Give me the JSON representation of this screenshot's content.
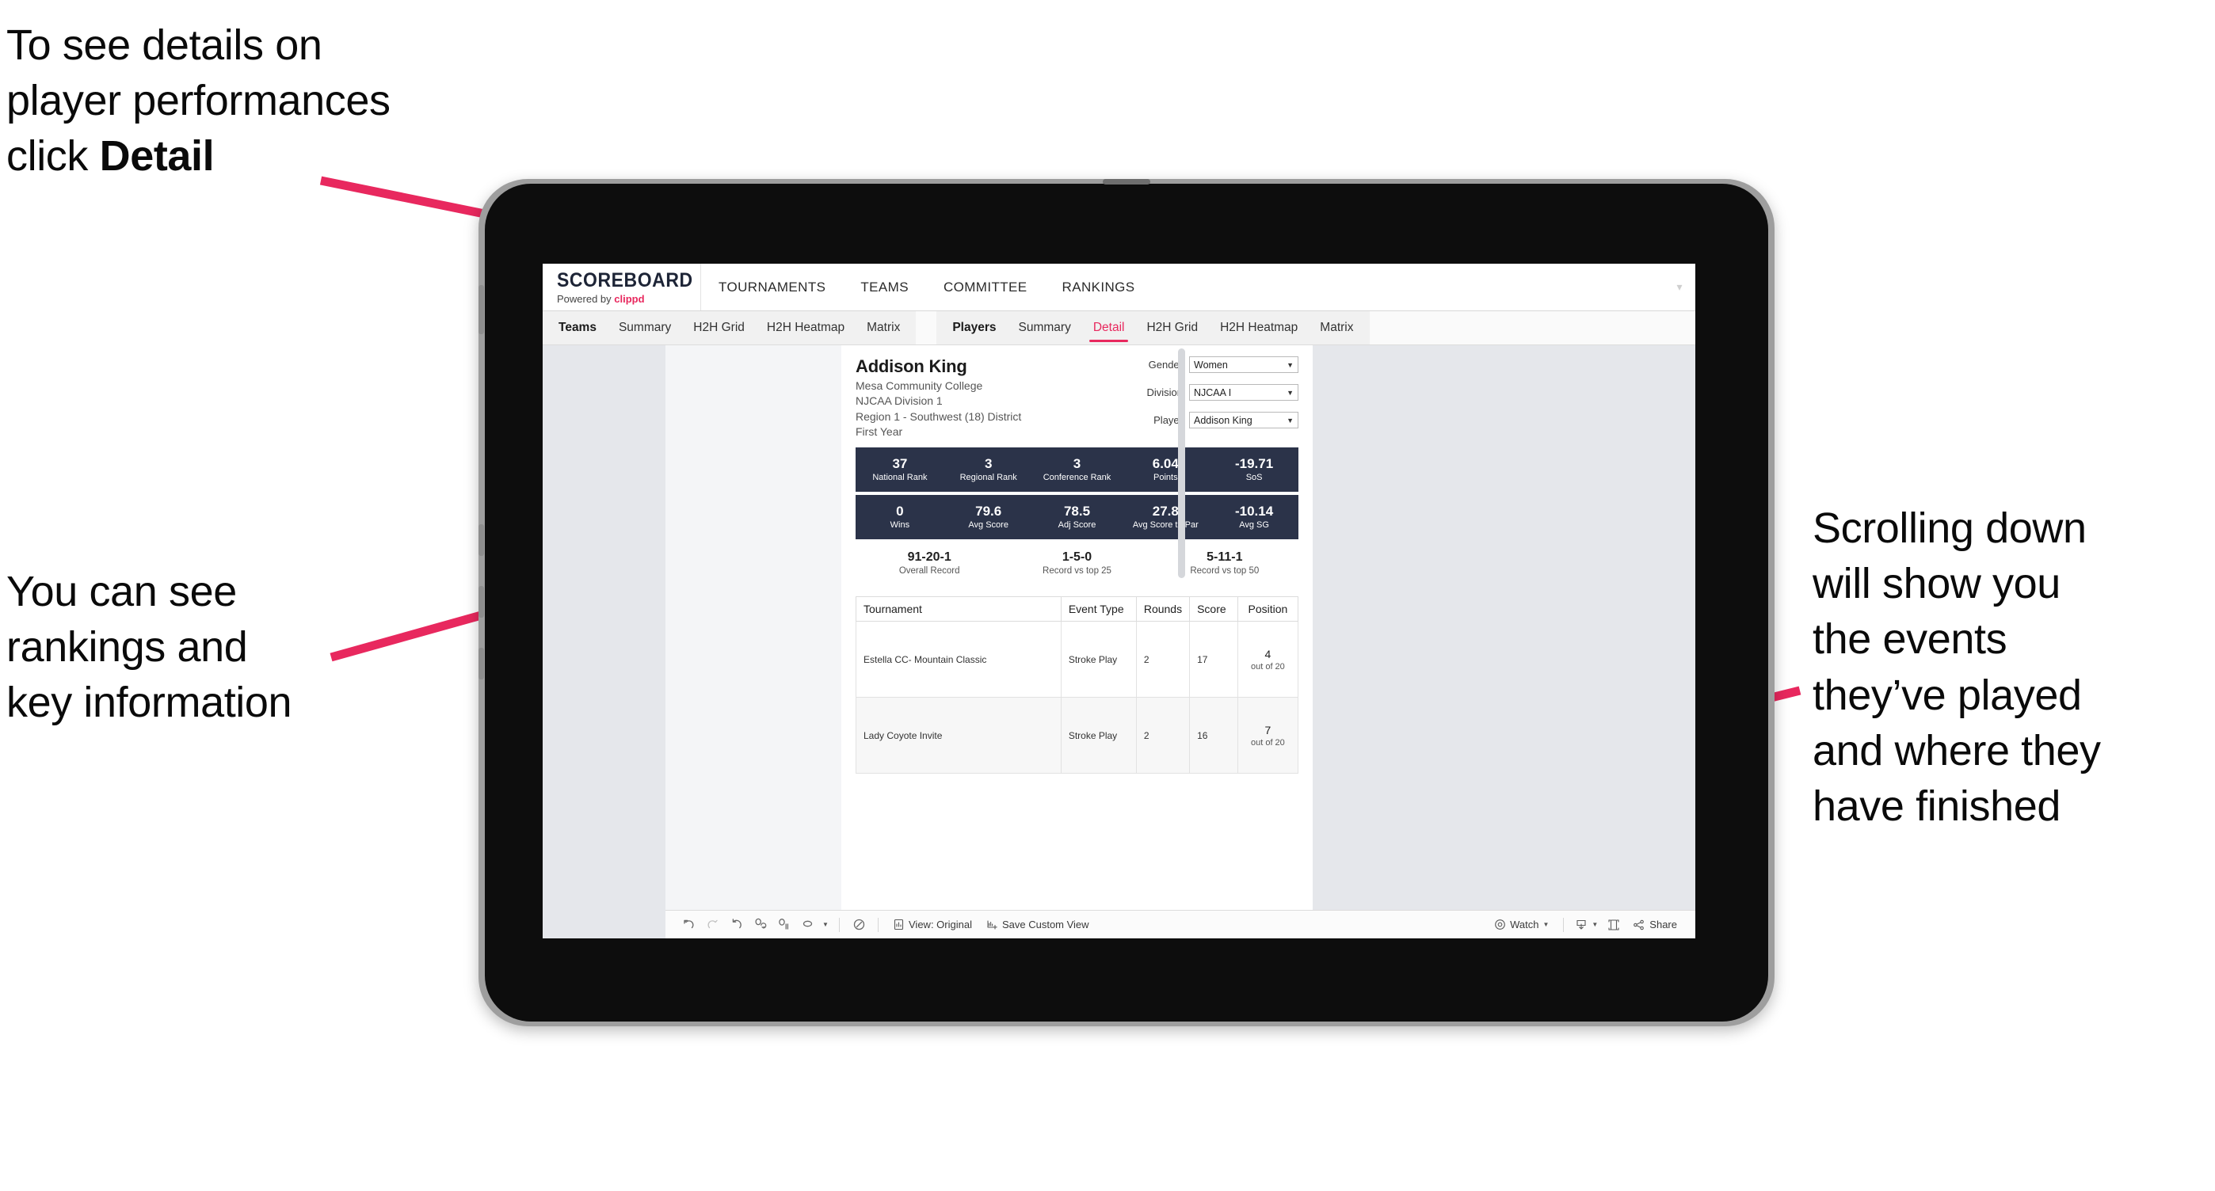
{
  "annotations": {
    "detail": "To see details on\nplayer performances\nclick ",
    "detail_bold": "Detail",
    "rankings": "You can see\nrankings and\nkey information",
    "scrolling": "Scrolling down\nwill show you\nthe events\nthey’ve played\nand where they\nhave finished"
  },
  "colors": {
    "accent": "#e8285e",
    "stat_bar": "#2b3349",
    "screen_bg": "#e5e7eb"
  },
  "header": {
    "brand_title": "SCOREBOARD",
    "brand_sub_prefix": "Powered by ",
    "brand_sub_link": "clippd",
    "nav": [
      {
        "label": "TOURNAMENTS"
      },
      {
        "label": "TEAMS"
      },
      {
        "label": "COMMITTEE"
      },
      {
        "label": "RANKINGS"
      }
    ]
  },
  "tabs": {
    "group_teams": [
      {
        "label": "Teams",
        "strong": true,
        "active": false
      },
      {
        "label": "Summary",
        "strong": false,
        "active": false
      },
      {
        "label": "H2H Grid",
        "strong": false,
        "active": false
      },
      {
        "label": "H2H Heatmap",
        "strong": false,
        "active": false
      },
      {
        "label": "Matrix",
        "strong": false,
        "active": false
      }
    ],
    "group_players": [
      {
        "label": "Players",
        "strong": true,
        "active": false
      },
      {
        "label": "Summary",
        "strong": false,
        "active": false
      },
      {
        "label": "Detail",
        "strong": false,
        "active": true
      },
      {
        "label": "H2H Grid",
        "strong": false,
        "active": false
      },
      {
        "label": "H2H Heatmap",
        "strong": false,
        "active": false
      },
      {
        "label": "Matrix",
        "strong": false,
        "active": false
      }
    ]
  },
  "player": {
    "name": "Addison King",
    "school": "Mesa Community College",
    "division": "NJCAA Division 1",
    "region": "Region 1 - Southwest (18) District",
    "year": "First Year"
  },
  "filters": [
    {
      "label": "Gender",
      "value": "Women"
    },
    {
      "label": "Division",
      "value": "NJCAA I"
    },
    {
      "label": "Player",
      "value": "Addison King"
    }
  ],
  "stats_row1": [
    {
      "value": "37",
      "label": "National Rank"
    },
    {
      "value": "3",
      "label": "Regional Rank"
    },
    {
      "value": "3",
      "label": "Conference Rank"
    },
    {
      "value": "6.04",
      "label": "Points"
    },
    {
      "value": "-19.71",
      "label": "SoS"
    }
  ],
  "stats_row2": [
    {
      "value": "0",
      "label": "Wins"
    },
    {
      "value": "79.6",
      "label": "Avg Score"
    },
    {
      "value": "78.5",
      "label": "Adj Score"
    },
    {
      "value": "27.8",
      "label": "Avg Score to Par"
    },
    {
      "value": "-10.14",
      "label": "Avg SG"
    }
  ],
  "records": [
    {
      "value": "91-20-1",
      "label": "Overall Record"
    },
    {
      "value": "1-5-0",
      "label": "Record vs top 25"
    },
    {
      "value": "5-11-1",
      "label": "Record vs top 50"
    }
  ],
  "events_table": {
    "columns": [
      "Tournament",
      "Event Type",
      "Rounds",
      "Score",
      "Position"
    ],
    "rows": [
      {
        "tournament": "Estella CC- Mountain Classic",
        "event_type": "Stroke Play",
        "rounds": "2",
        "score": "17",
        "position": "4",
        "position_sub": "out of 20"
      },
      {
        "tournament": "Lady Coyote Invite",
        "event_type": "Stroke Play",
        "rounds": "2",
        "score": "16",
        "position": "7",
        "position_sub": "out of 20"
      }
    ]
  },
  "toolbar": {
    "icons": [
      "undo-icon",
      "redo-icon",
      "revert-icon",
      "refresh-icon",
      "pause-icon",
      "autoupdate-icon"
    ],
    "history_icon": "history-icon",
    "view_label": "View: Original",
    "save_label": "Save Custom View",
    "watch_label": "Watch",
    "share_label": "Share",
    "download_icon": "download-icon",
    "fullscreen_icon": "fullscreen-icon"
  }
}
